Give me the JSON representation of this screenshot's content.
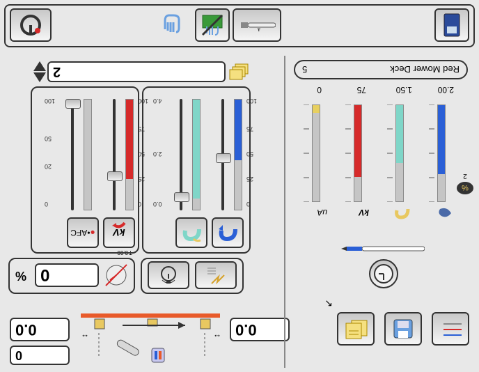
{
  "toolbar_left": {
    "btn1": "save-disk",
    "btn2": "notes",
    "btn3": "guns"
  },
  "top_readouts": {
    "left_small": "0",
    "left_big": "0.0",
    "right_big": "0.0"
  },
  "trim_panel": {
    "value": "0",
    "pct": "%",
    "side_label": "0.00",
    "side_label2": "T"
  },
  "spray_panel": {
    "btn_a": "spark",
    "btn_b": "timer"
  },
  "sliders": {
    "air1": {
      "label": "air-primary",
      "ticks": [
        "100",
        "75",
        "50",
        "25",
        "0"
      ],
      "value_pct": 55
    },
    "air2": {
      "label": "air-secondary",
      "ticks": [
        "4.0",
        "",
        "2.0",
        "",
        "0.0"
      ],
      "value_pct": 90
    },
    "kv": {
      "label": "kV",
      "ticks": [
        "100",
        "75",
        "50",
        "25",
        "0"
      ],
      "value_pct": 72
    },
    "afc": {
      "label": "•AFC",
      "ticks": [
        "100",
        "50",
        "",
        "20",
        "0"
      ],
      "value_pct": 0
    }
  },
  "status_bars": {
    "items": [
      {
        "name": "air-primary",
        "color": "#2a5fd6",
        "reading": "2.00",
        "fill_pct": 72
      },
      {
        "name": "air-secondary",
        "color": "#7fd6c8",
        "reading": "1.50",
        "fill_pct": 60
      },
      {
        "name": "kV",
        "color": "#d62a2a",
        "reading": "75",
        "fill_pct": 75
      },
      {
        "name": "uA",
        "color": "#e8d060",
        "reading": "0",
        "fill_pct": 8
      }
    ],
    "pct_icon_label": "%",
    "pct_value": "2"
  },
  "preset": {
    "name": "Red Mower Deck",
    "number": "5"
  },
  "spinner": {
    "value": "2"
  },
  "bottom_bar": {
    "btn_book": "program",
    "btn_mode1": "single",
    "btn_hand_cross": "manual-off",
    "btn_hand": "manual",
    "btn_ready": "ready"
  },
  "clock_icon": "clock",
  "pen_icon": "pen"
}
